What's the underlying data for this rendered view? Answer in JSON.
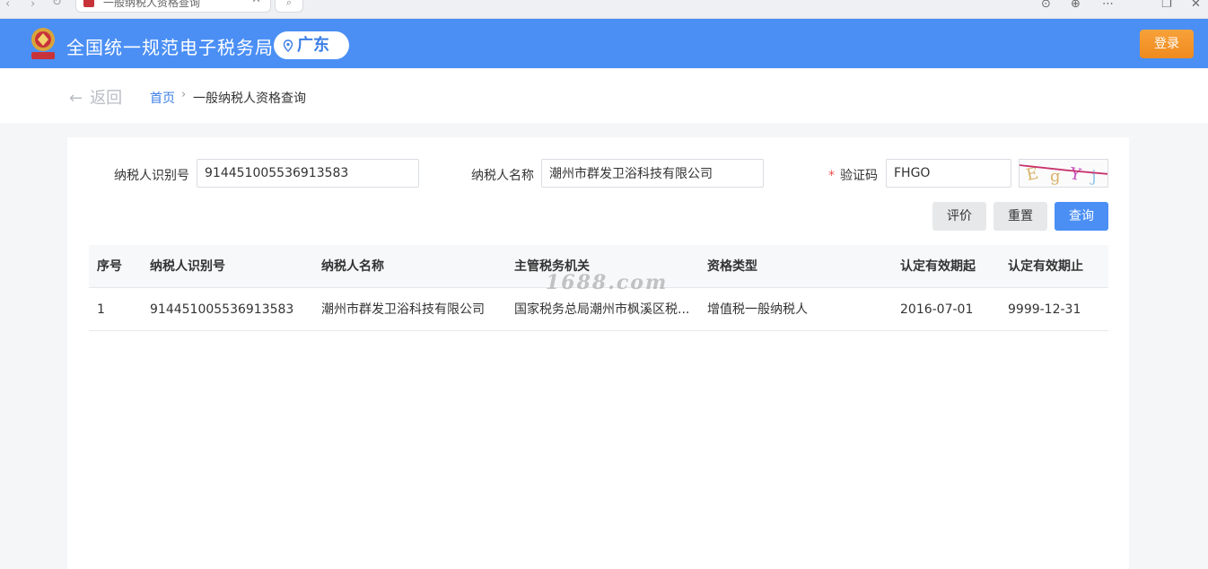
{
  "browser": {
    "tab_title": "一般纳税人资格查询",
    "tab_close": "✕",
    "search_glyph": "⌕"
  },
  "header": {
    "site_title": "全国统一规范电子税务局",
    "region": "广东",
    "login_label": "登录",
    "brand_color": "#4b8ff5"
  },
  "breadcrumb": {
    "back_label": "返回",
    "home": "首页",
    "separator": "›",
    "current": "一般纳税人资格查询"
  },
  "form": {
    "taxpayer_id_label": "纳税人识别号",
    "taxpayer_id_value": "914451005536913583",
    "taxpayer_name_label": "纳税人名称",
    "taxpayer_name_value": "潮州市群发卫浴科技有限公司",
    "captcha_required_mark": "*",
    "captcha_label": "验证码",
    "captcha_value": "FHGO",
    "captcha_image_text": "E g Y j"
  },
  "actions": {
    "evaluate_label": "评价",
    "reset_label": "重置",
    "query_label": "查询"
  },
  "table": {
    "columns": [
      "序号",
      "纳税人识别号",
      "纳税人名称",
      "主管税务机关",
      "资格类型",
      "认定有效期起",
      "认定有效期止"
    ],
    "rows": [
      [
        "1",
        "914451005536913583",
        "潮州市群发卫浴科技有限公司",
        "国家税务总局潮州市枫溪区税...",
        "增值税一般纳税人",
        "2016-07-01",
        "9999-12-31"
      ]
    ]
  },
  "watermark": "1688.com"
}
